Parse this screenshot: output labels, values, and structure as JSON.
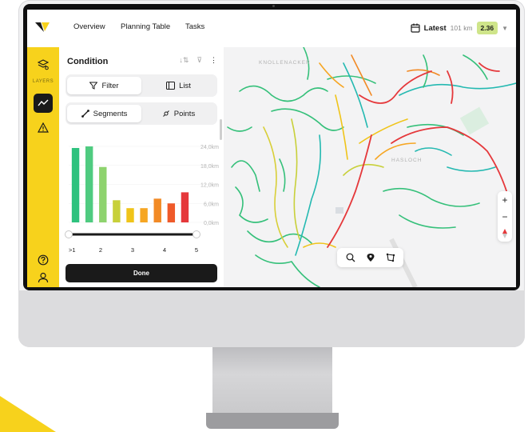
{
  "nav": {
    "overview": "Overview",
    "planning": "Planning Table",
    "tasks": "Tasks"
  },
  "latest": {
    "label": "Latest",
    "distance": "101 km",
    "score": "2.36"
  },
  "rail": {
    "layers_label": "LAYERS"
  },
  "panel": {
    "title": "Condition",
    "filter_label": "Filter",
    "list_label": "List",
    "segments_label": "Segments",
    "points_label": "Points",
    "done_label": "Done"
  },
  "chart_data": {
    "type": "bar",
    "categories": [
      "1.0",
      "1.5",
      "2.0",
      "2.5",
      "3.0",
      "3.5",
      "4.0",
      "4.5",
      "5.0"
    ],
    "values": [
      23.5,
      24.0,
      17.5,
      7.0,
      4.5,
      4.5,
      7.5,
      6.0,
      9.5
    ],
    "colors": [
      "#2ec27e",
      "#4fcb80",
      "#8ed36e",
      "#c8d03a",
      "#f0c419",
      "#f6a623",
      "#f28a25",
      "#ef5a2a",
      "#e5383b"
    ],
    "yticks": [
      "24,0km",
      "18,0km",
      "12,0km",
      "6,0km",
      "0,0km"
    ],
    "ylim": [
      0,
      24
    ],
    "xtick_labels": [
      ">1",
      "2",
      "3",
      "4",
      "5"
    ],
    "range_slider": [
      0,
      1
    ]
  },
  "map": {
    "labels": [
      "KNOLLENACKER",
      "HASLOCH"
    ]
  },
  "colors": {
    "accent": "#f7d21c",
    "dark": "#1a1a1a",
    "badge": "#cfe58a"
  }
}
